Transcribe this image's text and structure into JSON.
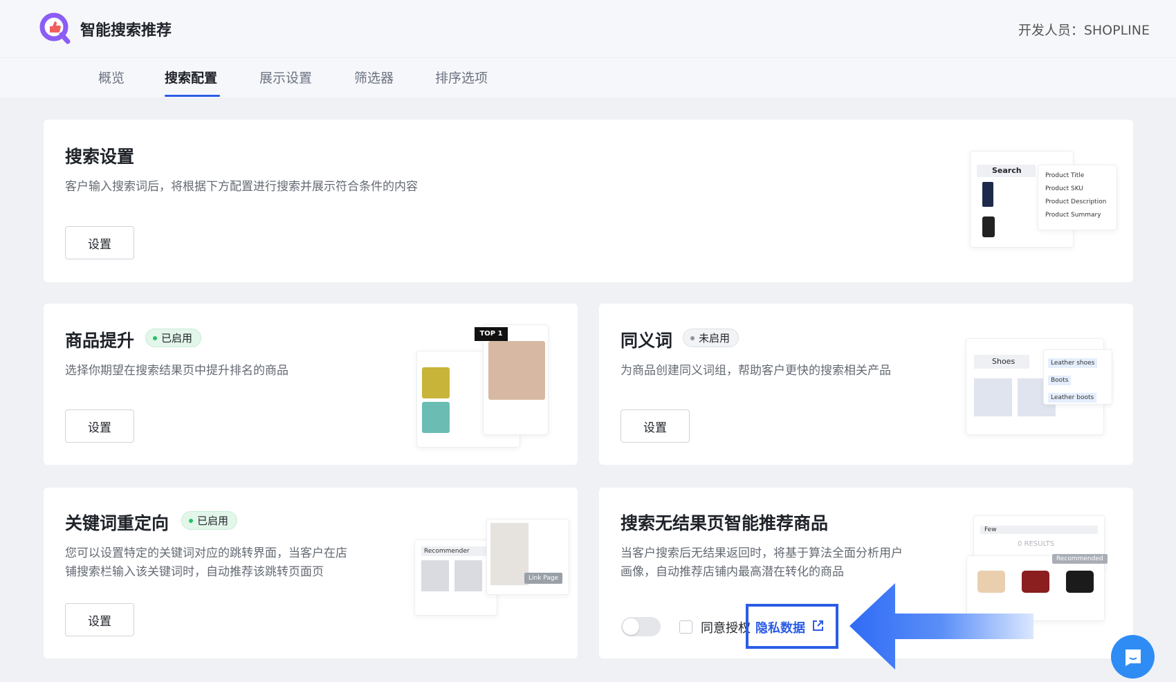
{
  "header": {
    "app_title": "智能搜索推荐",
    "developer": "开发人员：SHOPLINE"
  },
  "tabs": [
    {
      "label": "概览",
      "active": false
    },
    {
      "label": "搜索配置",
      "active": true
    },
    {
      "label": "展示设置",
      "active": false
    },
    {
      "label": "筛选器",
      "active": false
    },
    {
      "label": "排序选项",
      "active": false
    }
  ],
  "cards": {
    "search_settings": {
      "title": "搜索设置",
      "description": "客户输入搜索词后，将根据下方配置进行搜索并展示符合条件的内容",
      "button": "设置",
      "illustration": {
        "search": "Search",
        "options": [
          "Product Title",
          "Product SKU",
          "Product Description",
          "Product Summary"
        ]
      }
    },
    "boost": {
      "title": "商品提升",
      "badge": "已启用",
      "description": "选择你期望在搜索结果页中提升排名的商品",
      "button": "设置",
      "illustration": {
        "tag": "TOP 1"
      }
    },
    "synonyms": {
      "title": "同义词",
      "badge": "未启用",
      "description": "为商品创建同义词组，帮助客户更快的搜索相关产品",
      "button": "设置",
      "illustration": {
        "search": "Shoes",
        "tags": [
          "Leather shoes",
          "Boots",
          "Leather boots"
        ]
      }
    },
    "redirect": {
      "title": "关键词重定向",
      "badge": "已启用",
      "description_1": "您可以设置特定的关键词对应的跳转界面，当客户在店",
      "description_2": "铺搜索栏输入该关键词时，自动推荐该跳转页面页",
      "button": "设置",
      "illustration": {
        "label": "Recommender",
        "link": "Link Page"
      }
    },
    "no_result": {
      "title": "搜索无结果页智能推荐商品",
      "description_1": "当客户搜索后无结果返回时，将基于算法全面分析用户",
      "description_2": "画像，自动推荐店铺内最高潜在转化的商品",
      "toggle_on": false,
      "consent_checked": false,
      "consent_label": "同意授权",
      "privacy_link": "隐私数据",
      "illustration": {
        "search": "Few",
        "results": "0 RESULTS",
        "recommended": "Recommended"
      }
    }
  },
  "colors": {
    "accent": "#2b5ce6",
    "enabled": "#27c265",
    "disabled": "#8f959e",
    "chat": "#2f8cf5"
  }
}
